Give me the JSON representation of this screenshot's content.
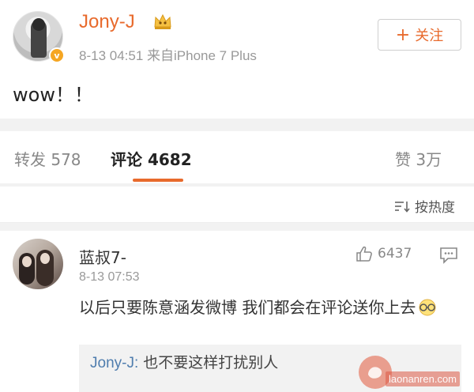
{
  "post": {
    "user_name": "Jony-J",
    "meta": "8-13 04:51  来自iPhone 7 Plus",
    "follow_label": "关注",
    "follow_plus": "+",
    "verified_badge": "v",
    "text": "wow！！"
  },
  "stats": {
    "repost": "转发 578",
    "comment": "评论 4682",
    "like": "赞 3万"
  },
  "sort": {
    "label": "按热度"
  },
  "comment": {
    "user": "蓝叔7-",
    "time": "8-13 07:53",
    "like_count": "6437",
    "text": "以后只要陈意涵发微博 我们都会在评论送你上去"
  },
  "reply": {
    "author": "Jony-J:",
    "body": " 也不要这样打扰别人"
  },
  "watermark": {
    "site": "laonanren.com"
  },
  "colors": {
    "accent": "#e86a2c",
    "link": "#4f7dae",
    "muted": "#999999"
  }
}
